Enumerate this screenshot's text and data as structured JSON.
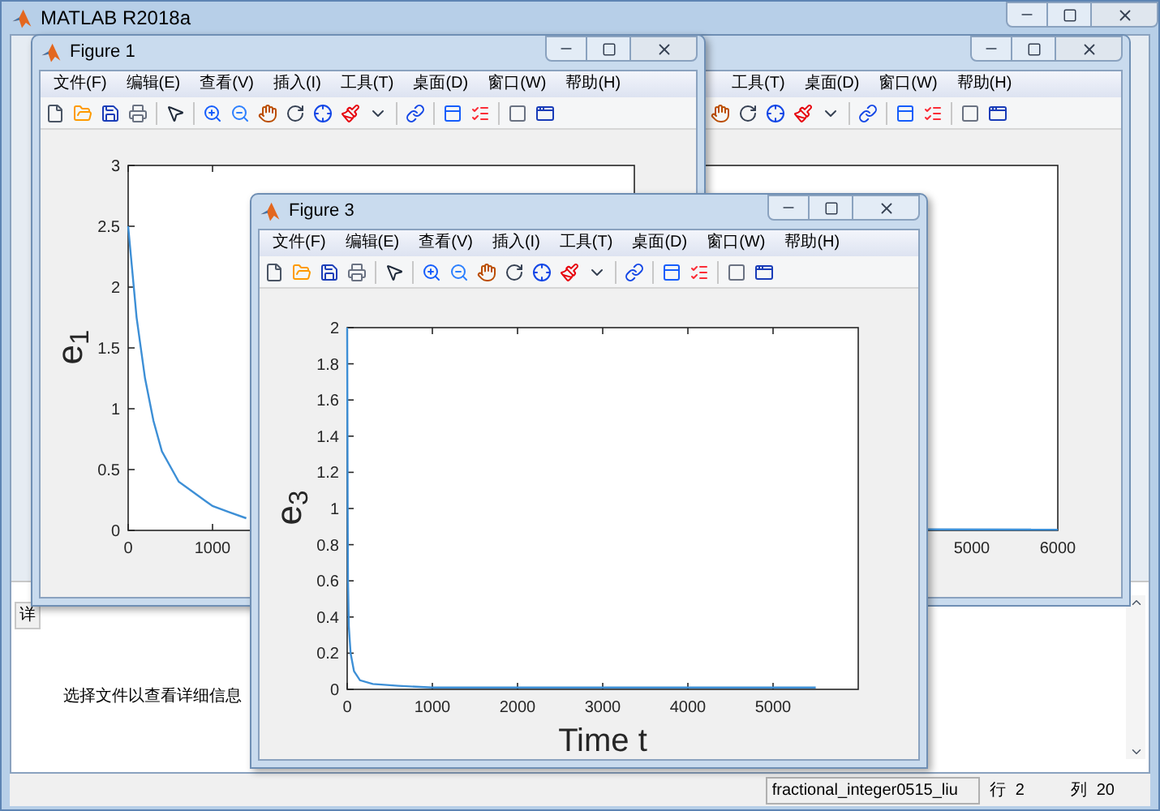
{
  "window": {
    "title": "MATLAB R2018a"
  },
  "details_pane": {
    "tab": "详",
    "message": "选择文件以查看详细信息"
  },
  "status_bar": {
    "file": "fractional_integer0515_liu",
    "row_label": "行",
    "row": "2",
    "col_label": "列",
    "col": "20"
  },
  "figure_2": {
    "menu": [
      "工具(T)",
      "桌面(D)",
      "窗口(W)",
      "帮助(H)"
    ],
    "x_tick_labels": [
      "5000",
      "6000"
    ]
  },
  "figure_1": {
    "title": "Figure 1",
    "menu": [
      "文件(F)",
      "编辑(E)",
      "查看(V)",
      "插入(I)",
      "工具(T)",
      "桌面(D)",
      "窗口(W)",
      "帮助(H)"
    ],
    "chart_data": {
      "type": "line",
      "ylabel": "e$_{1}$",
      "xlim": [
        0,
        6000
      ],
      "ylim": [
        0,
        3
      ],
      "xticks": [
        0,
        1000
      ],
      "yticks": [
        0,
        0.5,
        1,
        1.5,
        2,
        2.5,
        3
      ],
      "x": [
        0,
        100,
        200,
        300,
        400,
        600,
        800,
        1000,
        1200,
        1400
      ],
      "series": [
        {
          "color": "#3d8fd6",
          "values": [
            2.5,
            1.75,
            1.25,
            0.9,
            0.65,
            0.4,
            0.3,
            0.2,
            0.15,
            0.1
          ]
        }
      ]
    }
  },
  "figure_3": {
    "title": "Figure 3",
    "menu": [
      "文件(F)",
      "编辑(E)",
      "查看(V)",
      "插入(I)",
      "工具(T)",
      "桌面(D)",
      "窗口(W)",
      "帮助(H)"
    ],
    "chart_data": {
      "type": "line",
      "xlabel": "Time t",
      "ylabel": "e$_{3}$",
      "xlim": [
        0,
        6000
      ],
      "ylim": [
        0,
        2
      ],
      "xticks": [
        0,
        1000,
        2000,
        3000,
        4000,
        5000
      ],
      "yticks": [
        0,
        0.2,
        0.4,
        0.6,
        0.8,
        1,
        1.2,
        1.4,
        1.6,
        1.8,
        2
      ],
      "x": [
        0,
        5,
        10,
        20,
        40,
        80,
        150,
        300,
        600,
        1000,
        2000,
        3000,
        4000,
        5500
      ],
      "series": [
        {
          "color": "#3d8fd6",
          "values": [
            2,
            1,
            0.6,
            0.35,
            0.2,
            0.1,
            0.05,
            0.03,
            0.02,
            0.01,
            0.01,
            0.01,
            0.01,
            0.01
          ]
        }
      ]
    }
  }
}
